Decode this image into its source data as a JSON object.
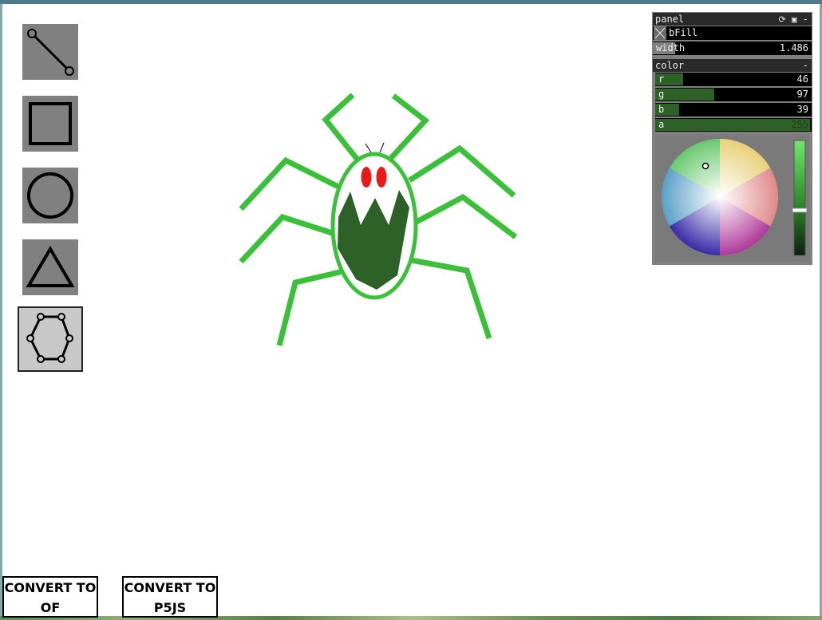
{
  "tools": [
    {
      "name": "line",
      "selected": false
    },
    {
      "name": "rectangle",
      "selected": false
    },
    {
      "name": "circle",
      "selected": false
    },
    {
      "name": "triangle",
      "selected": false
    },
    {
      "name": "polygon",
      "selected": true
    }
  ],
  "panel": {
    "title": "panel",
    "fill_label": "bFill",
    "width_label": "width",
    "width_value": "1.486",
    "color_group_label": "color",
    "color_group_toggle": "-",
    "header_icons": [
      "refresh-icon",
      "save-icon",
      "minimize-icon"
    ],
    "minimize": "-",
    "r_label": "r",
    "r_value": "46",
    "g_label": "g",
    "g_value": "97",
    "b_label": "b",
    "b_value": "39",
    "a_label": "a",
    "a_value": "255",
    "fill_color": "#2e6127"
  },
  "buttons": {
    "convert_of": "CONVERT TO OF",
    "convert_p5js": "CONVERT TO P5JS"
  },
  "colors": {
    "stroke_green": "#3cc03c",
    "fill_dark_green": "#2e6127",
    "eye_red": "#e81a1a"
  }
}
